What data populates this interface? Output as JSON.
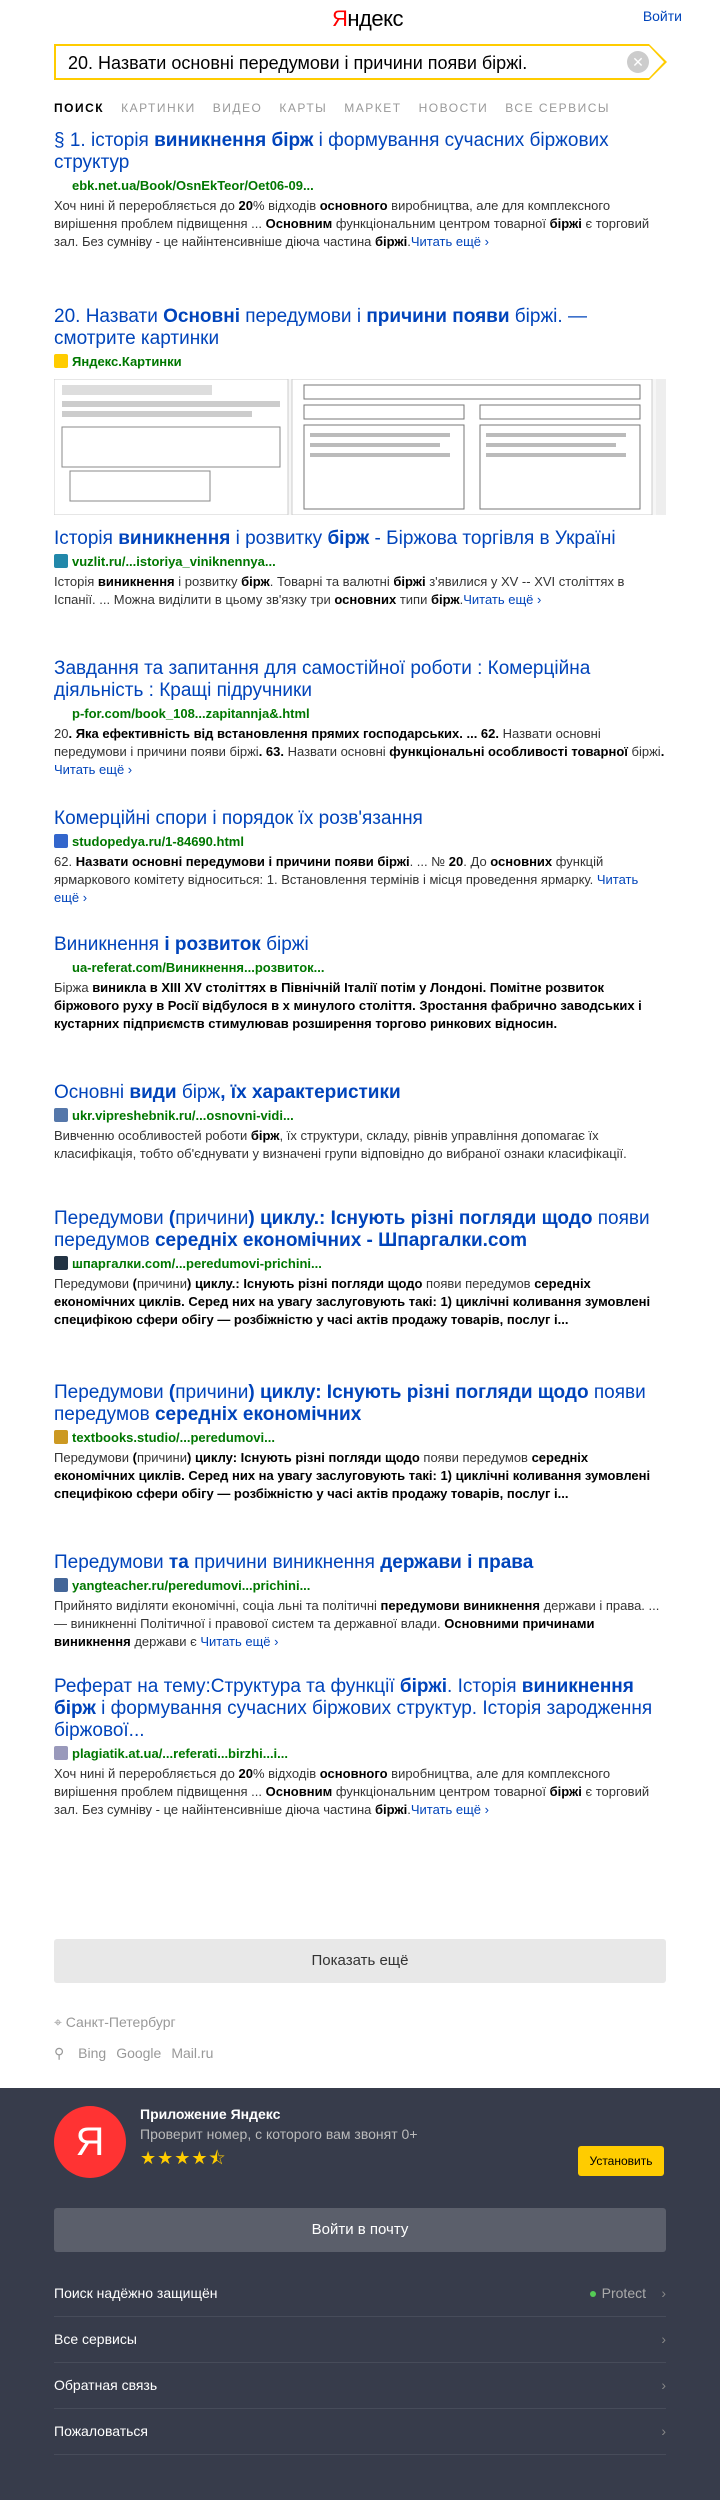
{
  "header": {
    "logo": "Яндекс",
    "login": "Войти"
  },
  "search": {
    "query": "20. Назвати основні передумови і причини появи біржі."
  },
  "tabs": [
    "ПОИСК",
    "КАРТИНКИ",
    "ВИДЕО",
    "КАРТЫ",
    "МАРКЕТ",
    "НОВОСТИ",
    "ВСЕ СЕРВИСЫ"
  ],
  "results": [
    {
      "title": [
        "§ 1. історія ",
        "виникнення бірж",
        " і формування сучасних біржових структур"
      ],
      "url": "ebk.net.ua/Book/OsnEkTeor/Oet06-09...",
      "snippet": [
        "Хоч нині й переробляється до ",
        "20",
        "% відходів ",
        "основного",
        " виробництва, але для комплексного вирішення проблем підвищення ... ",
        "Основним",
        " функціональним центром товарної ",
        "біржі",
        " є торговий зал. Без сумніву - це найінтенсивніше діюча частина ",
        "біржі",
        "."
      ],
      "more": "Читать ещё ›"
    },
    {
      "title": [
        "20. Назвати ",
        "Основні",
        " передумови і ",
        "причини появи",
        " біржі. — смотрите картинки"
      ],
      "url": "Яндекс.Картинки"
    },
    {
      "title": [
        "Історія ",
        "виникнення",
        " і розвитку ",
        "бірж",
        " - Біржова торгівля в Україні"
      ],
      "url": "vuzlit.ru/...istoriya_viniknennya...",
      "snippet": [
        "Історія ",
        "виникнення",
        " і розвитку ",
        "бірж",
        ". Товарні та валютні ",
        "біржі",
        " з'явилися у XV -- XVI століттях в Іспанії. ... Можна виділити в цьому зв'язку три ",
        "основних",
        " типи ",
        "бірж",
        "."
      ],
      "more": "Читать ещё ›"
    },
    {
      "title": [
        "Завдання та запитання для самостійної роботи : Комерційна діяльність : Кращі підручники"
      ],
      "url": "p-for.com/book_108...zapitannja&.html",
      "snippet": [
        "20",
        ". Яка ефективність від встановлення прямих господарських. ... 62. ",
        "Назвати основні передумови і причини появи біржі",
        ". 63. ",
        "Назвати основні",
        " функціональні особливості товарної ",
        "біржі",
        ". "
      ],
      "more": "Читать ещё ›"
    },
    {
      "title": [
        "Комерційні спори і порядок їх розв'язання"
      ],
      "url": "studopedya.ru/1-84690.html",
      "snippet": [
        "62. ",
        "Назвати основні передумови і причини появи біржі",
        ". ... № ",
        "20",
        ". До ",
        "основних",
        " функцій ярмаркового комітету відноситься: 1. Встановлення термінів і місця проведення ярмарку. "
      ],
      "more": "Читать ещё ›"
    },
    {
      "title": [
        "Виникнення",
        " і розвиток ",
        "біржі"
      ],
      "url": "ua-referat.com/Виникнення...розвиток...",
      "snippet": [
        "Біржа",
        " виникла в XIII XV століттях в Північній Італії потім у Лондоні. Помітне розвиток біржового руху в Росії відбулося в х минулого століття. Зростання фабрично заводських і кустарних підприємств стимулював розширення торгово ринкових відносин."
      ]
    },
    {
      "title": [
        "Основні",
        " види ",
        "бірж",
        ", їх характеристики"
      ],
      "url": "ukr.vipreshebnik.ru/...osnovni-vidi...",
      "snippet": [
        "Вивченню особливостей роботи ",
        "бірж",
        ", їх структури, складу, рівнів управління допомагає їх класифікація, тобто об'єднувати у визначені групи відповідно до вибраної ознаки класифікації."
      ]
    },
    {
      "title": [
        "Передумови",
        " (",
        "причини",
        ") циклу.: Існують різні погляди щодо ",
        "появи передумов",
        " середніх економічних - Шпаргалки.com"
      ],
      "url": "шпаргалки.com/...peredumovi-prichini...",
      "snippet": [
        "Передумови",
        " (",
        "причини",
        ") циклу.: Існують різні погляди щодо ",
        "появи передумов",
        " середніх економічних циклів. Серед них на увагу заслуговують такі: 1) циклічні коливання зумовлені специфікою сфери обігу — розбіжністю у часі актів продажу товарів, послуг і..."
      ]
    },
    {
      "title": [
        "Передумови",
        " (",
        "причини",
        ") циклу: Існують різні погляди щодо ",
        "появи передумов",
        " середніх економічних"
      ],
      "url": "textbooks.studio/...peredumovi...",
      "snippet": [
        "Передумови",
        " (",
        "причини",
        ") циклу: Існують різні погляди щодо ",
        "появи передумов",
        " середніх економічних циклів. Серед них на увагу заслуговують такі: 1) циклічні коливання зумовлені специфікою сфери обігу — розбіжністю у часі актів продажу товарів, послуг і..."
      ]
    },
    {
      "title": [
        "Передумови",
        " та ",
        "причини виникнення",
        " держави і права"
      ],
      "url": "yangteacher.ru/peredumovi...prichini...",
      "snippet": [
        "Прийнято виділяти економічні, соціа льні та політичні ",
        "передумови виникнення",
        " держави і права. ... — виникненні Політичної і правової систем та державної влади. ",
        "Основними причинами виникнення",
        " держави є "
      ],
      "more": "Читать ещё ›"
    },
    {
      "title": [
        "Реферат на тему:Структура та функції ",
        "біржі",
        ". Історія ",
        "виникнення бірж",
        " і формування сучасних біржових структур. Історія зародження біржової..."
      ],
      "url": "plagiatik.at.ua/...referati...birzhi...i...",
      "snippet": [
        "Хоч нині й переробляється до ",
        "20",
        "% відходів ",
        "основного",
        " виробництва, але для комплексного вирішення проблем підвищення ... ",
        "Основним",
        " функціональним центром товарної ",
        "біржі",
        " є торговий зал. Без сумніву - це найінтенсивніше діюча частина ",
        "біржі",
        "."
      ],
      "more": "Читать ещё ›"
    }
  ],
  "show_more": "Показать ещё",
  "location": "Санкт-Петербург",
  "other_engines": [
    "Bing",
    "Google",
    "Mail.ru"
  ],
  "footer": {
    "app_logo_letter": "Я",
    "app_title": "Приложение Яндекс",
    "app_desc": "Проверит номер, с которого вам звонят",
    "app_badge": "0+",
    "rating": 4.5,
    "install": "Установить",
    "mail_button": "Войти в почту",
    "rows": [
      "Поиск надёжно защищён",
      "Все сервисы",
      "Обратная связь",
      "Пожаловаться"
    ],
    "protect": "Protect"
  }
}
